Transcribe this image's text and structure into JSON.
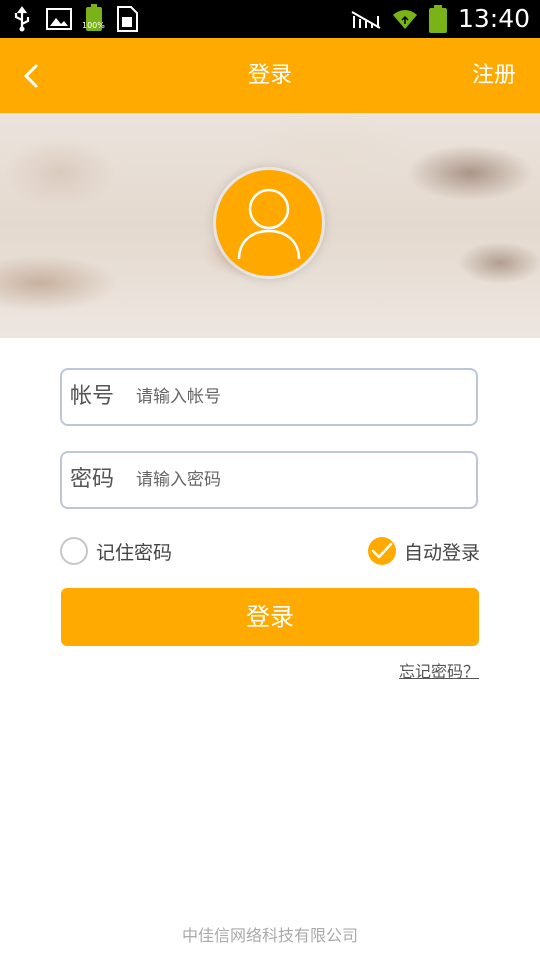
{
  "status_bar": {
    "time": "13:40",
    "battery_small_pct": "100%",
    "icons": [
      "usb-icon",
      "image-icon",
      "battery-icon",
      "sim-icon",
      "no-signal-icon",
      "wifi-icon",
      "battery-icon"
    ]
  },
  "titlebar": {
    "title": "登录",
    "register_label": "注册",
    "back_icon": "chevron-left-icon"
  },
  "form": {
    "account_label": "帐号",
    "account_placeholder": "请输入帐号",
    "password_label": "密码",
    "password_placeholder": "请输入密码",
    "remember_label": "记住密码",
    "remember_checked": false,
    "auto_login_label": "自动登录",
    "auto_login_checked": true,
    "submit_label": "登录",
    "forgot_label": "忘记密码？"
  },
  "footer": {
    "company": "中佳信网络科技有限公司"
  },
  "colors": {
    "accent": "#ffaa00",
    "field_border": "#bcc6d8"
  }
}
